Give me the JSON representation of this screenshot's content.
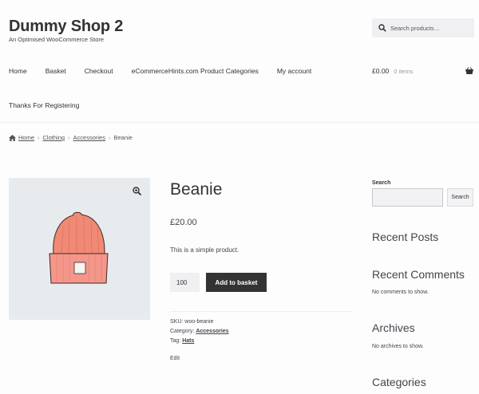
{
  "header": {
    "site_title": "Dummy Shop 2",
    "tagline": "An Optimised WooCommerce Store",
    "search_placeholder": "Search products…"
  },
  "nav": {
    "items": [
      "Home",
      "Basket",
      "Checkout",
      "eCommerceHints.com Product Categories",
      "My account"
    ],
    "second_row": "Thanks For Registering"
  },
  "cart": {
    "amount": "£0.00",
    "count": "0 items"
  },
  "breadcrumb": {
    "home": "Home",
    "clothing": "Clothing",
    "accessories": "Accessories",
    "current": "Beanie"
  },
  "product": {
    "title": "Beanie",
    "price": "£20.00",
    "description": "This is a simple product.",
    "quantity": "100",
    "add_to_basket": "Add to basket",
    "sku_label": "SKU:",
    "sku": "woo-beanie",
    "category_label": "Category:",
    "category": "Accessories",
    "tag_label": "Tag:",
    "tag": "Hats",
    "edit": "Edit",
    "image_color": "#f08a75"
  },
  "sidebar": {
    "search_label": "Search",
    "search_button": "Search",
    "recent_posts": "Recent Posts",
    "recent_comments": "Recent Comments",
    "no_comments": "No comments to show.",
    "archives": "Archives",
    "no_archives": "No archives to show.",
    "categories": "Categories"
  }
}
